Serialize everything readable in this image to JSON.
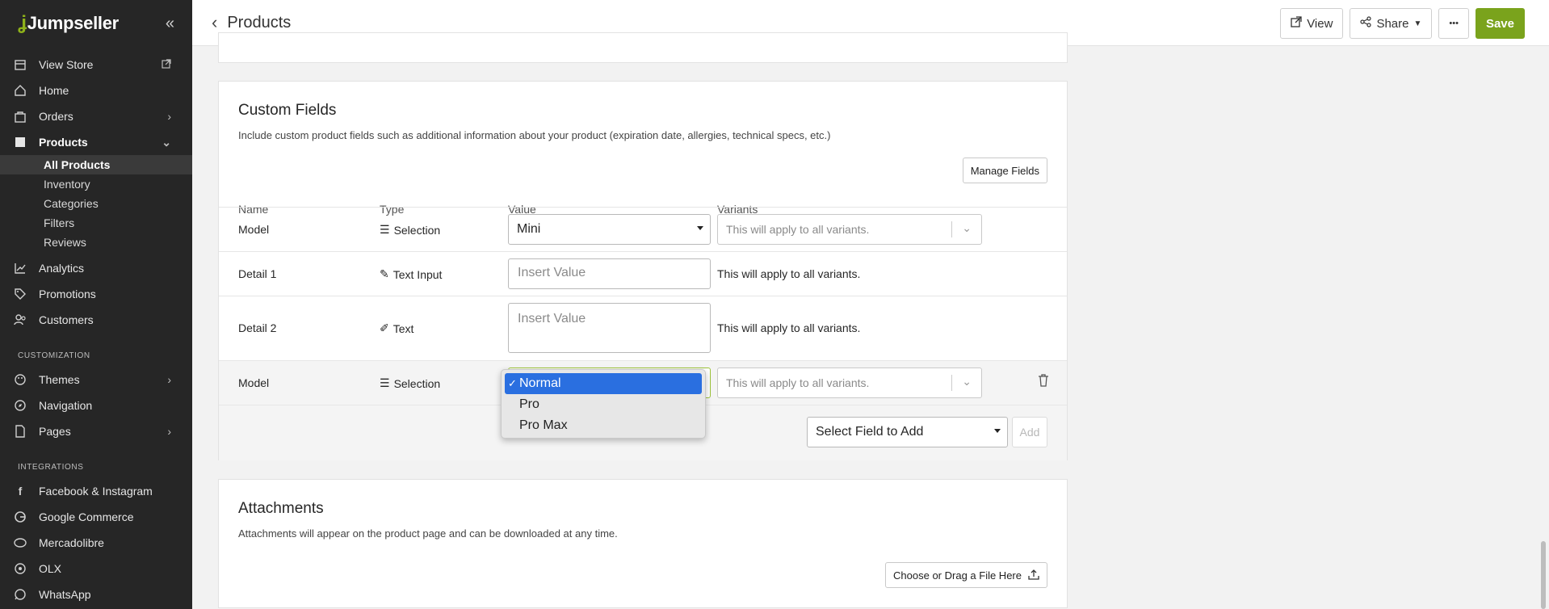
{
  "sidebar": {
    "brand": "Jumpseller",
    "nav_main": [
      {
        "label": "View Store",
        "icon": "store-icon"
      },
      {
        "label": "Home",
        "icon": "home-icon"
      },
      {
        "label": "Orders",
        "icon": "bag-icon"
      },
      {
        "label": "Products",
        "icon": "box-icon"
      }
    ],
    "products_sub": [
      "All Products",
      "Inventory",
      "Categories",
      "Filters",
      "Reviews"
    ],
    "nav_main2": [
      {
        "label": "Analytics",
        "icon": "chart-icon"
      },
      {
        "label": "Promotions",
        "icon": "tag-icon"
      },
      {
        "label": "Customers",
        "icon": "users-icon"
      }
    ],
    "customization_label": "CUSTOMIZATION",
    "nav_custom": [
      {
        "label": "Themes",
        "icon": "palette-icon"
      },
      {
        "label": "Navigation",
        "icon": "compass-icon"
      },
      {
        "label": "Pages",
        "icon": "file-icon"
      }
    ],
    "integrations_label": "INTEGRATIONS",
    "nav_integrations": [
      {
        "label": "Facebook & Instagram",
        "icon": "facebook-icon"
      },
      {
        "label": "Google Commerce",
        "icon": "google-icon"
      },
      {
        "label": "Mercadolibre",
        "icon": "handshake-icon"
      },
      {
        "label": "OLX",
        "icon": "olx-icon"
      },
      {
        "label": "WhatsApp",
        "icon": "whatsapp-icon"
      }
    ]
  },
  "topbar": {
    "title": "Products",
    "view_label": "View",
    "share_label": "Share",
    "more_label": "•••",
    "save_label": "Save"
  },
  "custom_fields": {
    "title": "Custom Fields",
    "description": "Include custom product fields such as additional information about your product (expiration date, allergies, technical specs, etc.)",
    "manage_label": "Manage Fields",
    "columns": [
      "Name",
      "Type",
      "Value",
      "Variants"
    ],
    "rows": [
      {
        "name": "Model",
        "type": "Selection",
        "value": "Mini",
        "variants": "This will apply to all variants."
      },
      {
        "name": "Detail 1",
        "type": "Text Input",
        "placeholder": "Insert Value",
        "variants": "This will apply to all variants."
      },
      {
        "name": "Detail 2",
        "type": "Text",
        "placeholder": "Insert Value",
        "variants": "This will apply to all variants."
      },
      {
        "name": "Model",
        "type": "Selection",
        "value": "Normal",
        "variants": "This will apply to all variants."
      }
    ],
    "dropdown_options": [
      "Normal",
      "Pro",
      "Pro Max"
    ],
    "select_field_label": "Select Field to Add",
    "add_label": "Add"
  },
  "attachments": {
    "title": "Attachments",
    "description": "Attachments will appear on the product page and can be downloaded at any time.",
    "upload_label": "Choose or Drag a File Here"
  },
  "colors": {
    "accent": "#7aa31c",
    "sidebar_bg": "#262626",
    "selected_option": "#2a6fe0"
  }
}
